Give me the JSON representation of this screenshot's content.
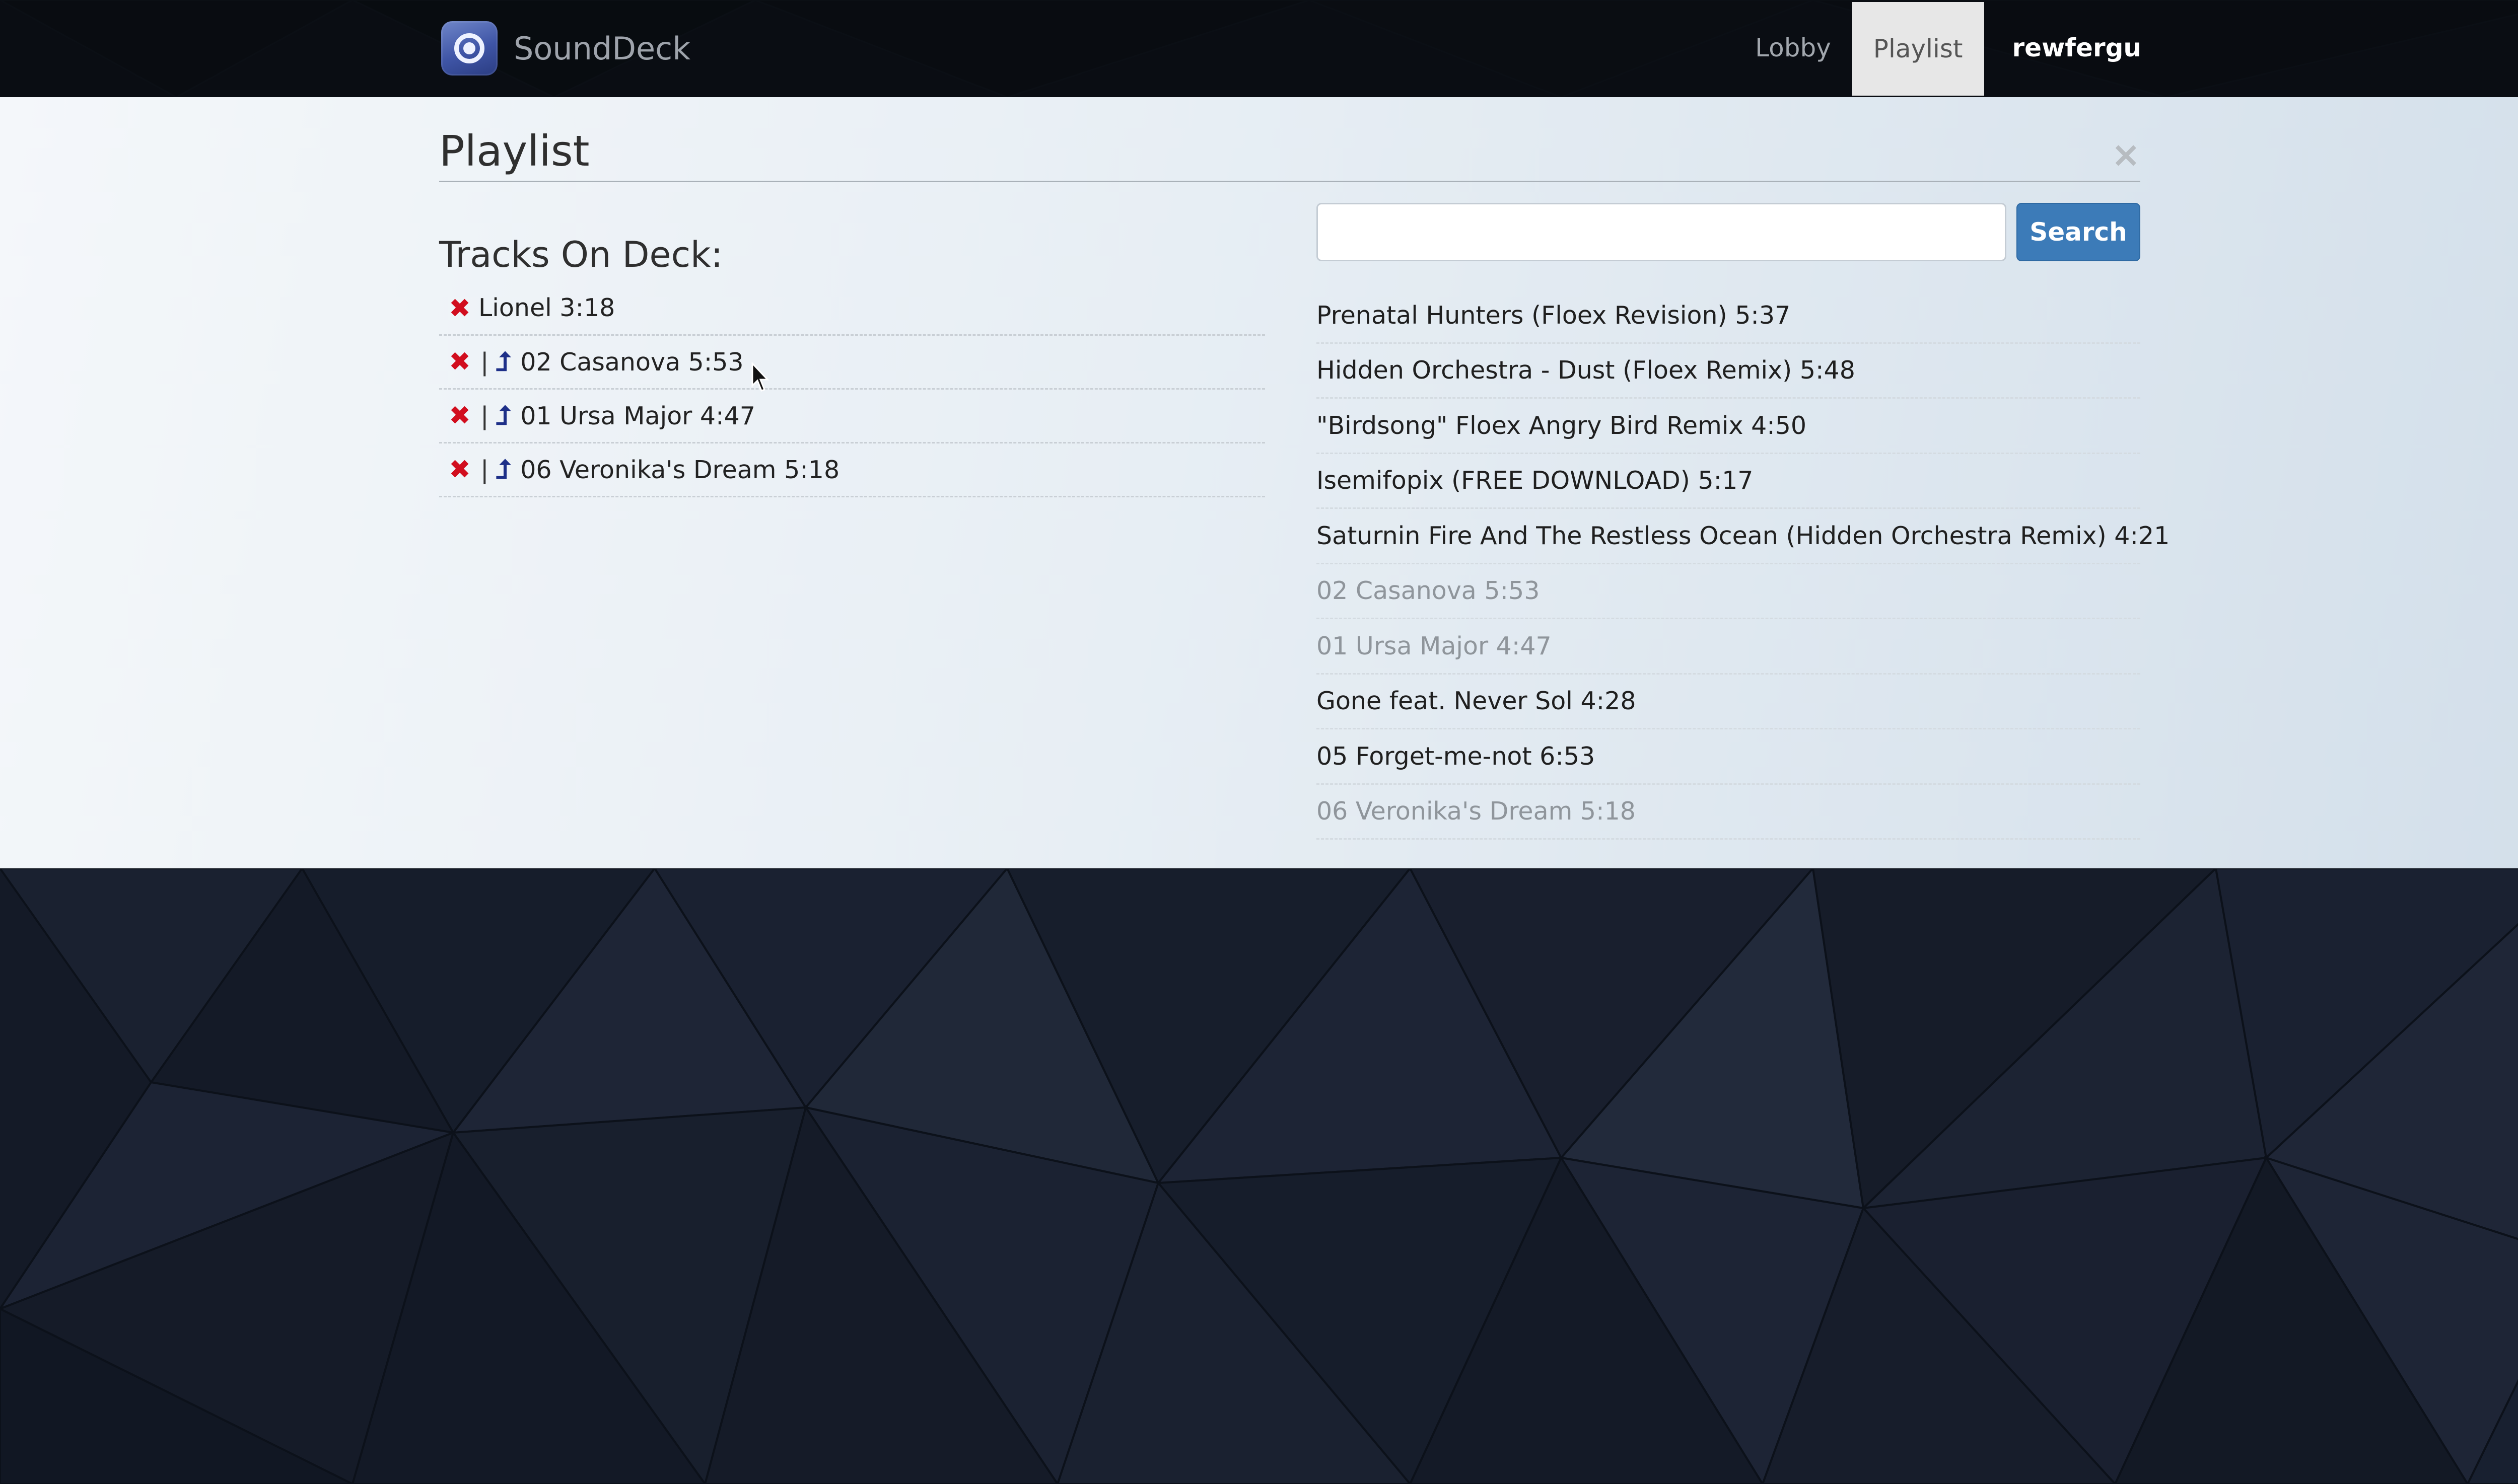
{
  "app": {
    "name": "SoundDeck",
    "logo_icon": "speaker-icon"
  },
  "nav": {
    "items": [
      {
        "label": "Lobby",
        "active": false
      },
      {
        "label": "Playlist",
        "active": true
      }
    ],
    "user": "rewfergu"
  },
  "page": {
    "title": "Playlist",
    "close_icon": "close-icon",
    "close_label": "×"
  },
  "deck": {
    "heading": "Tracks On Deck:",
    "remove_icon": "✖",
    "separator": "|",
    "promote_icon": "⮥",
    "tracks": [
      {
        "title": "Lionel 3:18",
        "can_promote": false
      },
      {
        "title": "02 Casanova 5:53",
        "can_promote": true
      },
      {
        "title": "01 Ursa Major 4:47",
        "can_promote": true
      },
      {
        "title": "06 Veronika's Dream 5:18",
        "can_promote": true
      }
    ]
  },
  "search": {
    "value": "",
    "placeholder": "",
    "button_label": "Search"
  },
  "results": [
    {
      "title": "Prenatal Hunters (Floex Revision) 5:37",
      "queued": false
    },
    {
      "title": "Hidden Orchestra - Dust (Floex Remix) 5:48",
      "queued": false
    },
    {
      "title": "\"Birdsong\" Floex Angry Bird Remix 4:50",
      "queued": false
    },
    {
      "title": "Isemifopix (FREE DOWNLOAD) 5:17",
      "queued": false
    },
    {
      "title": "Saturnin Fire And The Restless Ocean (Hidden Orchestra Remix) 4:21",
      "queued": false
    },
    {
      "title": "02 Casanova 5:53",
      "queued": true
    },
    {
      "title": "01 Ursa Major 4:47",
      "queued": true
    },
    {
      "title": "Gone feat. Never Sol 4:28",
      "queued": false
    },
    {
      "title": "05 Forget-me-not 6:53",
      "queued": false
    },
    {
      "title": "06 Veronika's Dream 5:18",
      "queued": true
    }
  ],
  "colors": {
    "navbar_bg": "#0b0e13",
    "accent_button": "#3c7bb8",
    "remove_icon": "#d10d1e",
    "promote_icon": "#1d2f88",
    "queued_text": "#8f959b"
  }
}
